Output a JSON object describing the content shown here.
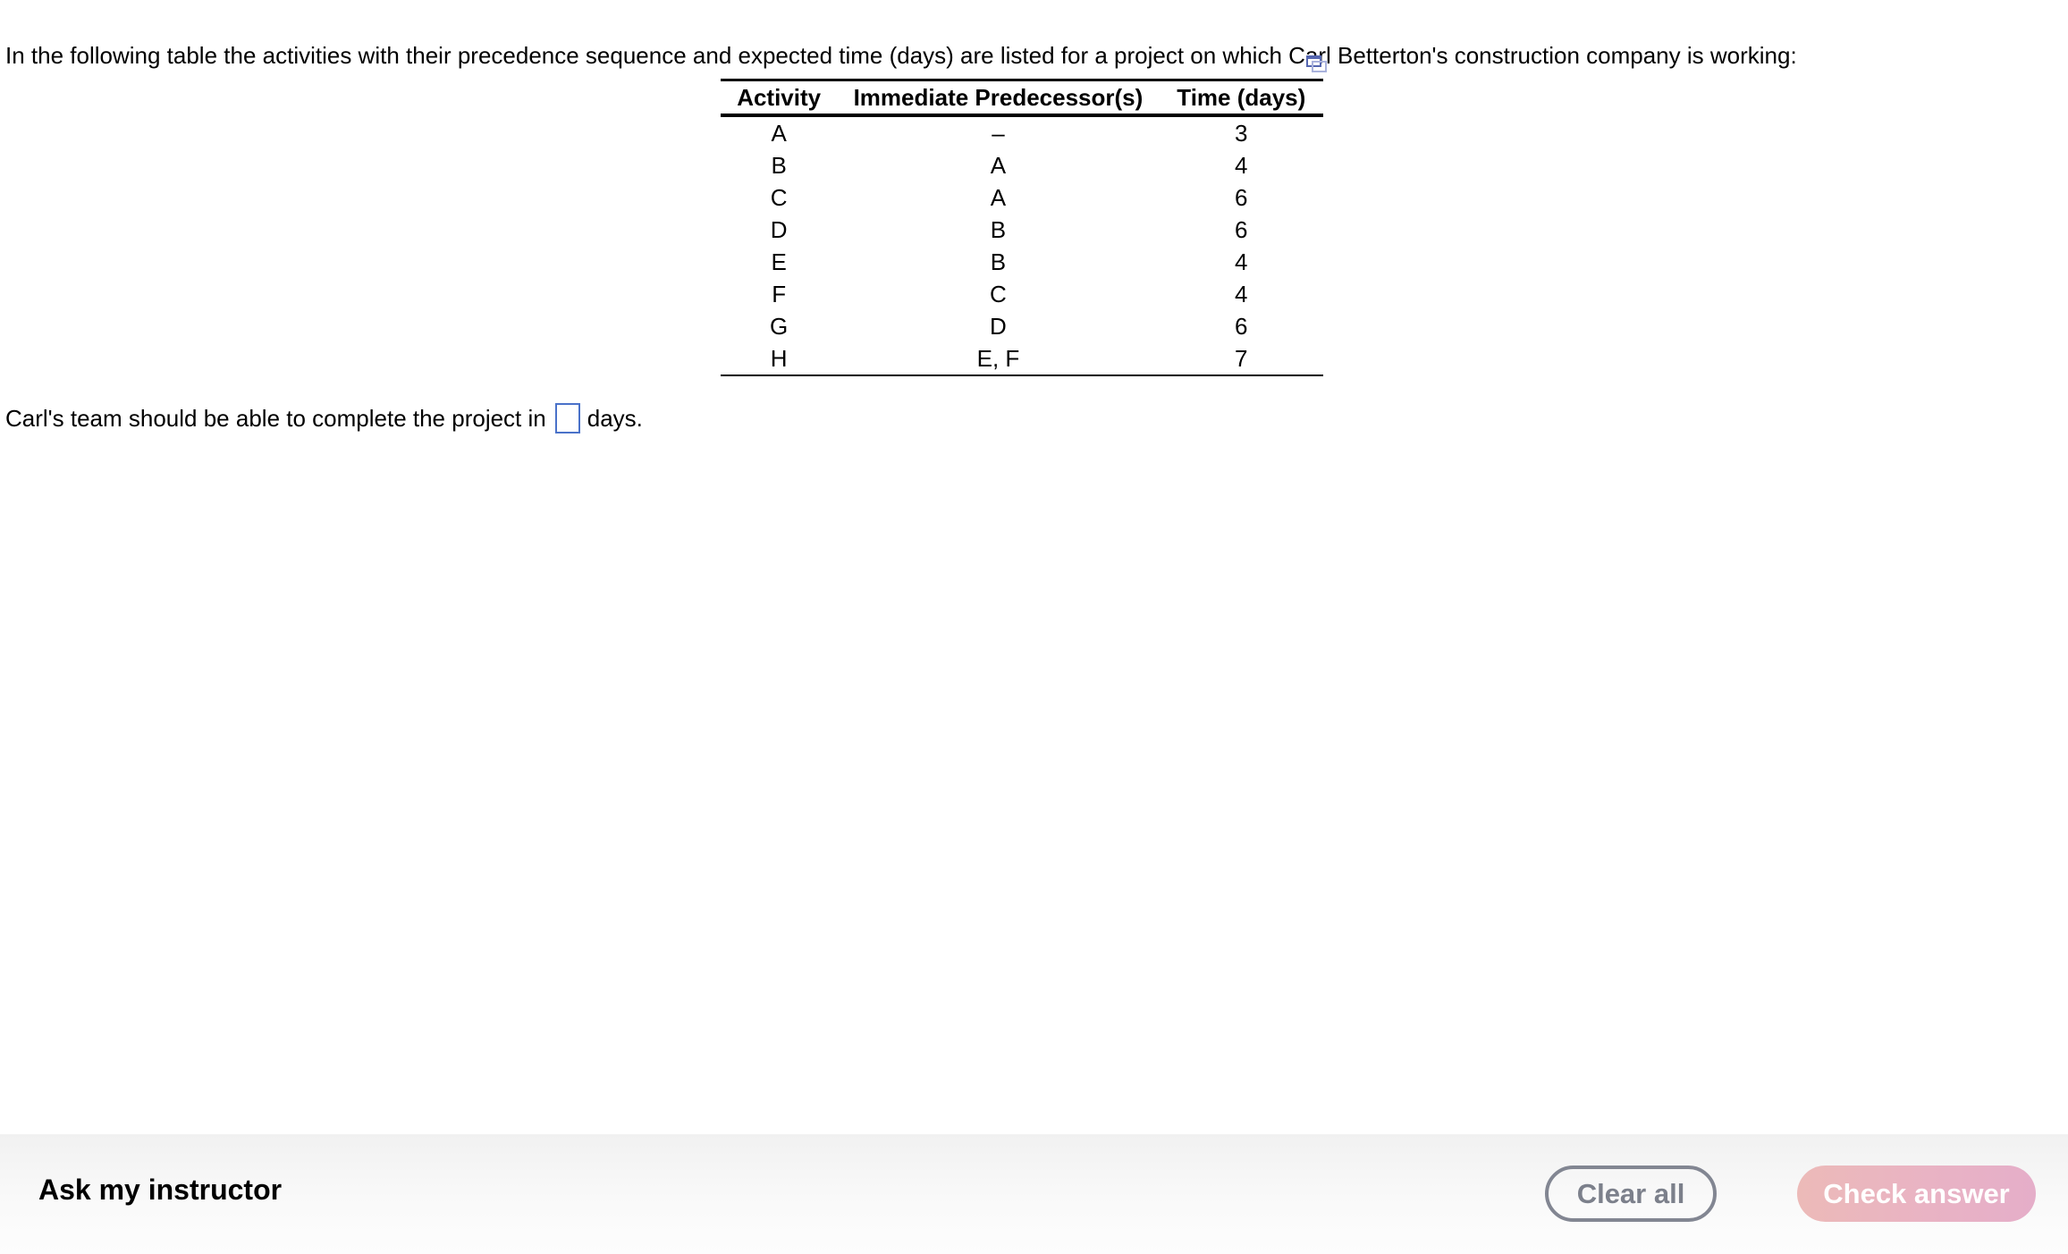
{
  "question": {
    "intro": "In the following table the activities with their precedence sequence and expected time (days) are listed for a project on which Carl Betterton's construction company is working:",
    "table": {
      "expand_icon": "expand-window-icon",
      "headers": [
        "Activity",
        "Immediate Predecessor(s)",
        "Time (days)"
      ],
      "rows": [
        {
          "activity": "A",
          "predecessors": "–",
          "time": "3"
        },
        {
          "activity": "B",
          "predecessors": "A",
          "time": "4"
        },
        {
          "activity": "C",
          "predecessors": "A",
          "time": "6"
        },
        {
          "activity": "D",
          "predecessors": "B",
          "time": "6"
        },
        {
          "activity": "E",
          "predecessors": "B",
          "time": "4"
        },
        {
          "activity": "F",
          "predecessors": "C",
          "time": "4"
        },
        {
          "activity": "G",
          "predecessors": "D",
          "time": "6"
        },
        {
          "activity": "H",
          "predecessors": "E, F",
          "time": "7"
        }
      ]
    },
    "answer": {
      "prefix": "Carl's team should be able to complete the project in",
      "value": "",
      "suffix": "days."
    }
  },
  "footer": {
    "ask_label": "Ask my instructor",
    "clear_label": "Clear all",
    "check_label": "Check answer",
    "colors": {
      "clear_border": "#828692",
      "check_bg_start": "#ecbab8",
      "check_bg_end": "#e5aec9",
      "input_border": "#4a72c9"
    }
  }
}
